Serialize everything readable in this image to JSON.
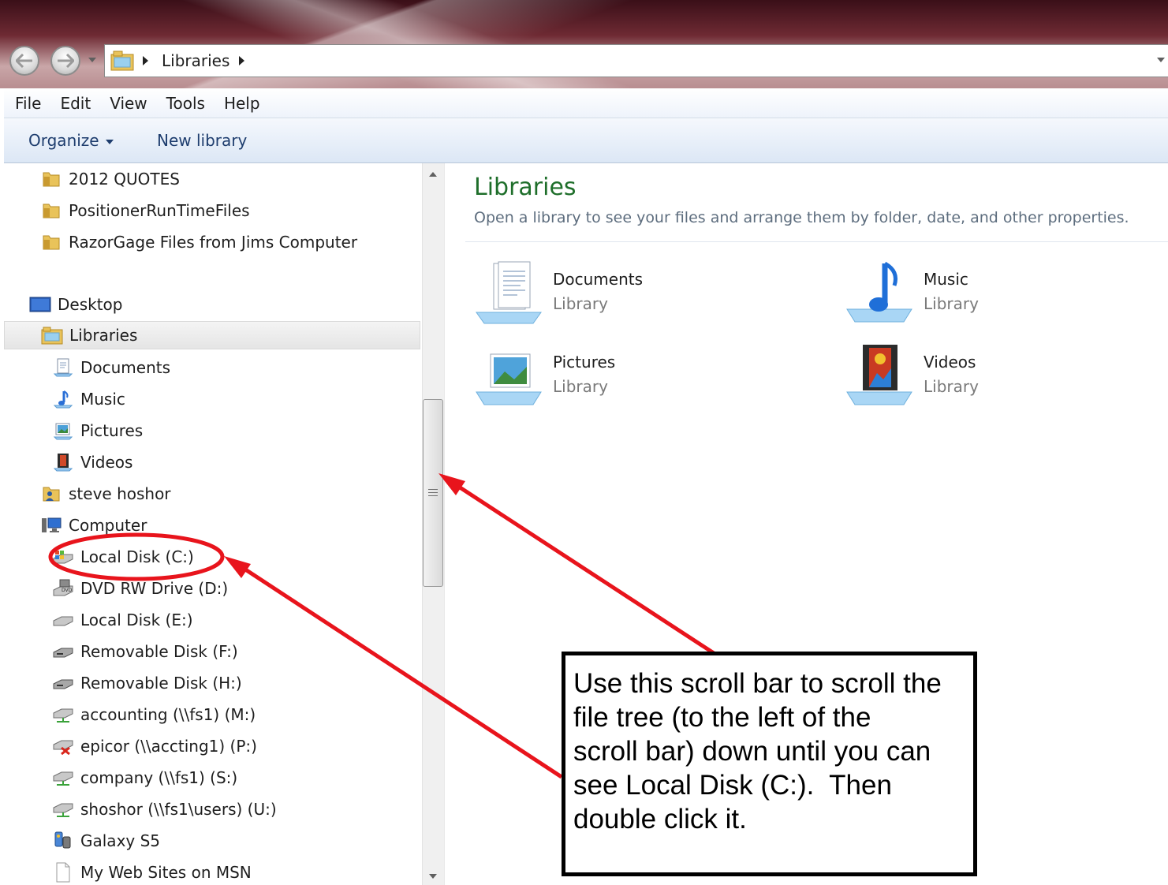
{
  "window": {
    "breadcrumb": "Libraries"
  },
  "menu": {
    "items": [
      "File",
      "Edit",
      "View",
      "Tools",
      "Help"
    ]
  },
  "toolbar": {
    "organize_label": "Organize",
    "new_library_label": "New library"
  },
  "nav": {
    "items": [
      {
        "label": "2012 QUOTES",
        "icon": "folder-icon"
      },
      {
        "label": "PositionerRunTimeFiles",
        "icon": "folder-icon"
      },
      {
        "label": "RazorGage Files from Jims Computer",
        "icon": "folder-icon"
      },
      {
        "label": "Desktop",
        "icon": "desktop-icon"
      },
      {
        "label": "Libraries",
        "icon": "libraries-icon",
        "selected": true
      },
      {
        "label": "Documents",
        "icon": "documents-icon"
      },
      {
        "label": "Music",
        "icon": "music-icon"
      },
      {
        "label": "Pictures",
        "icon": "pictures-icon"
      },
      {
        "label": "Videos",
        "icon": "videos-icon"
      },
      {
        "label": "steve hoshor",
        "icon": "user-folder-icon"
      },
      {
        "label": "Computer",
        "icon": "computer-icon"
      },
      {
        "label": "Local Disk (C:)",
        "icon": "system-drive-icon"
      },
      {
        "label": "DVD RW Drive (D:)",
        "icon": "dvd-drive-icon"
      },
      {
        "label": "Local Disk (E:)",
        "icon": "drive-icon"
      },
      {
        "label": "Removable Disk (F:)",
        "icon": "removable-drive-icon"
      },
      {
        "label": "Removable Disk (H:)",
        "icon": "removable-drive-icon"
      },
      {
        "label": "accounting (\\\\fs1) (M:)",
        "icon": "network-drive-icon"
      },
      {
        "label": "epicor (\\\\accting1) (P:)",
        "icon": "disconnected-network-drive-icon"
      },
      {
        "label": "company (\\\\fs1) (S:)",
        "icon": "network-drive-icon"
      },
      {
        "label": "shoshor (\\\\fs1\\users) (U:)",
        "icon": "network-drive-icon"
      },
      {
        "label": "Galaxy S5",
        "icon": "phone-icon"
      },
      {
        "label": "My Web Sites on MSN",
        "icon": "page-icon"
      }
    ]
  },
  "content": {
    "title": "Libraries",
    "subtitle": "Open a library to see your files and arrange them by folder, date, and other properties.",
    "libraries": [
      {
        "name": "Documents",
        "type": "Library",
        "icon": "documents-library-icon"
      },
      {
        "name": "Music",
        "type": "Library",
        "icon": "music-library-icon"
      },
      {
        "name": "Pictures",
        "type": "Library",
        "icon": "pictures-library-icon"
      },
      {
        "name": "Videos",
        "type": "Library",
        "icon": "videos-library-icon"
      }
    ]
  },
  "annotation": {
    "callout_lines": [
      "Use this scroll bar to scroll the",
      "file tree (to the left of the",
      "scroll bar) down until you can",
      "see Local Disk (C:).  Then",
      "double click it."
    ],
    "color": "#e8141c"
  },
  "colors": {
    "library_title": "#1e6e2a",
    "subtitle": "#5d6d7e",
    "toolbar_text": "#1e3d6e"
  }
}
